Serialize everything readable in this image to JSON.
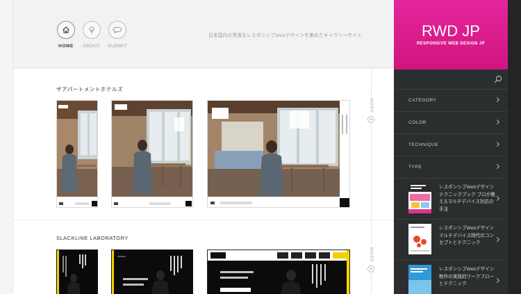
{
  "nav": {
    "items": [
      {
        "label": "HOME",
        "active": true,
        "icon": "home-icon"
      },
      {
        "label": "ABOUT",
        "active": false,
        "icon": "lightbulb-icon"
      },
      {
        "label": "SUBMIT",
        "active": false,
        "icon": "speech-bubble-icon"
      }
    ]
  },
  "header": {
    "tagline": "日本国内の秀逸なレスポンシブWebデザインを集めたギャラリーサイト"
  },
  "sections": [
    {
      "title": "ザアパートメントホテルズ",
      "more_label": "MORE",
      "screenshots": [
        {
          "kind": "smartphone",
          "headline": "まるで家にいる",
          "badge": "THE APARTMENT HOTELS"
        },
        {
          "kind": "tablet",
          "headline": "まるで我が",
          "badge": "THE APARTMENT HOTELS"
        },
        {
          "kind": "desktop",
          "headline": "まるで我が家にいる",
          "badge": "THE APARTMENT HOTELS"
        }
      ]
    },
    {
      "title": "SLACKLINE LABORATORY",
      "more_label": "MORE",
      "screenshots": [
        {
          "kind": "smartphone",
          "headline": "カラダ、ココロ、美しく",
          "sub": "SLACKLINE + FITNESS"
        },
        {
          "kind": "tablet",
          "headline": "カラダ、ココロ、美しく",
          "sub": "SLACKLINE + FITNESS"
        },
        {
          "kind": "desktop",
          "headline": "カラダ、ココロ、美しく",
          "sub": "SLACKLINE + FITNESS"
        }
      ]
    }
  ],
  "sidebar": {
    "logo_text": "RWD JP",
    "logo_subtitle": "RESPONSIVE WEB DESIGN JP",
    "menu": [
      "CATEGORY",
      "COLOR",
      "TECHNIQUE",
      "TYPE"
    ],
    "books": [
      {
        "title": "レスポンシブWebデザイン テクニックブック プロが教えるマルチデバイス対応の手法",
        "cover_color": "#f06aa8"
      },
      {
        "title": "レスポンシブWebデザイン マルチデバイス時代のコンセプトとテクニック",
        "cover_color": "#ffffff"
      },
      {
        "title": "レスポンシブWebデザイン 制作の実践的ワークフローとテクニック",
        "cover_color": "#2f9ad8"
      }
    ]
  },
  "colors": {
    "brand_pink": "#e01d95",
    "sidebar_bg": "#2b2e2e",
    "accent_yellow": "#f3d000"
  }
}
